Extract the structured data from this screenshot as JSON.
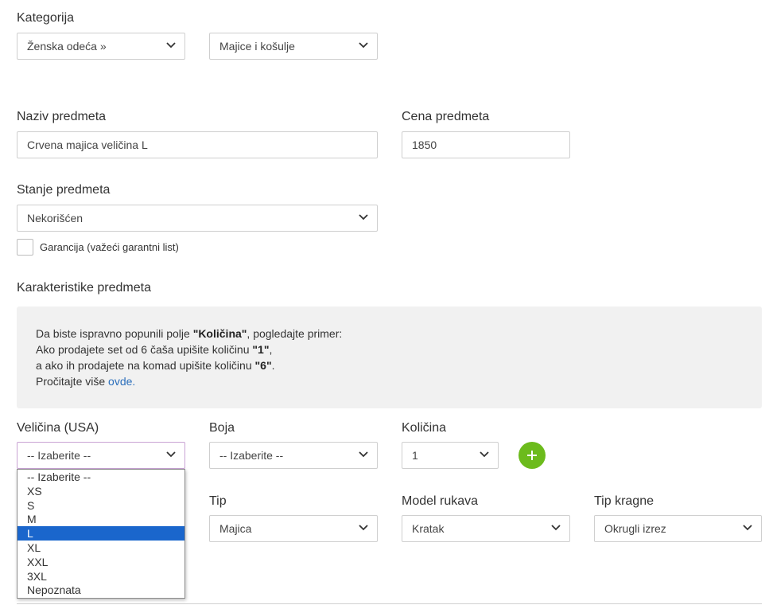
{
  "category": {
    "label": "Kategorija",
    "select1": "Ženska odeća »",
    "select2": "Majice i košulje"
  },
  "item_name": {
    "label": "Naziv predmeta",
    "value": "Crvena majica veličina L"
  },
  "item_price": {
    "label": "Cena predmeta",
    "value": "1850"
  },
  "condition": {
    "label": "Stanje predmeta",
    "value": "Nekorišćen",
    "warranty_label": "Garancija (važeći garantni list)"
  },
  "characteristics": {
    "label": "Karakteristike predmeta",
    "info": {
      "l1_pre": "Da biste ispravno popunili polje ",
      "l1_bold": "\"Količina\"",
      "l1_post": ", pogledajte primer:",
      "l2_pre": "Ako prodajete set od 6 čaša upišite količinu ",
      "l2_bold": "\"1\"",
      "l2_post": ",",
      "l3_pre": "a ako ih prodajete na komad upišite količinu ",
      "l3_bold": "\"6\"",
      "l3_post": ".",
      "l4_pre": "Pročitajte više ",
      "l4_link": "ovde."
    }
  },
  "size": {
    "label": "Veličina (USA)",
    "value": "-- Izaberite --",
    "options": [
      "-- Izaberite --",
      "XS",
      "S",
      "M",
      "L",
      "XL",
      "XXL",
      "3XL",
      "Nepoznata"
    ],
    "highlighted": "L"
  },
  "color": {
    "label": "Boja",
    "value": "-- Izaberite --"
  },
  "quantity": {
    "label": "Količina",
    "value": "1"
  },
  "type": {
    "label": "Tip",
    "value": "Majica"
  },
  "sleeve": {
    "label": "Model rukava",
    "value": "Kratak"
  },
  "collar": {
    "label": "Tip kragne",
    "value": "Okrugli izrez"
  },
  "colors": {
    "plus_button": "#6cbb1c",
    "selected_option": "#1a66cc",
    "link": "#2a6ebb"
  },
  "icons": {
    "select_arrow": "chevron-down-icon",
    "add": "plus-icon"
  }
}
